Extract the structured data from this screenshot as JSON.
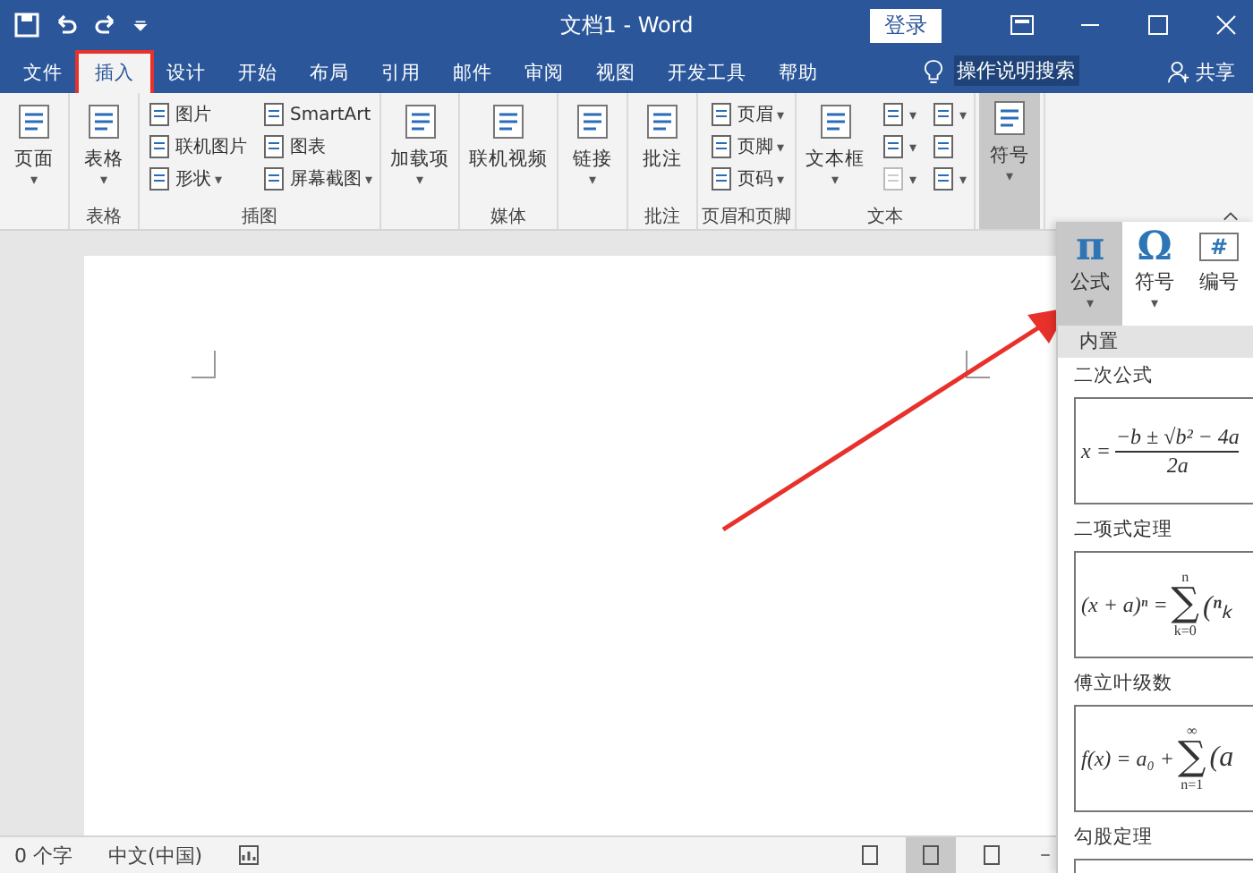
{
  "window": {
    "title": "文档1  -  Word",
    "login": "登录"
  },
  "tabs": [
    {
      "label": "文件",
      "selected": false,
      "highlighted": false
    },
    {
      "label": "插入",
      "selected": true,
      "highlighted": true
    },
    {
      "label": "设计",
      "selected": false,
      "highlighted": false
    },
    {
      "label": "开始",
      "selected": false,
      "highlighted": false
    },
    {
      "label": "布局",
      "selected": false,
      "highlighted": false
    },
    {
      "label": "引用",
      "selected": false,
      "highlighted": false
    },
    {
      "label": "邮件",
      "selected": false,
      "highlighted": false
    },
    {
      "label": "审阅",
      "selected": false,
      "highlighted": false
    },
    {
      "label": "视图",
      "selected": false,
      "highlighted": false
    },
    {
      "label": "开发工具",
      "selected": false,
      "highlighted": false
    },
    {
      "label": "帮助",
      "selected": false,
      "highlighted": false
    }
  ],
  "tell_me": "操作说明搜索",
  "share": "共享",
  "ribbon_groups": [
    {
      "items": [
        {
          "kind": "large",
          "label": "页面",
          "caret": "▾",
          "selected": false
        }
      ]
    },
    {
      "label": "表格",
      "items": [
        {
          "kind": "large",
          "label": "表格",
          "caret": "▾",
          "selected": false
        }
      ]
    },
    {
      "label": "插图",
      "items": [
        {
          "kind": "stack",
          "entries": [
            {
              "label": "图片",
              "disabled": false
            },
            {
              "label": "联机图片",
              "disabled": false
            },
            {
              "label": "形状",
              "caret": "▾",
              "disabled": false
            }
          ]
        },
        {
          "kind": "stack",
          "entries": [
            {
              "label": "SmartArt",
              "disabled": false
            },
            {
              "label": "图表",
              "disabled": false
            },
            {
              "label": "屏幕截图",
              "caret": "▾",
              "disabled": false
            }
          ]
        }
      ]
    },
    {
      "items": [
        {
          "kind": "large",
          "label": "加载项",
          "caret": "▾",
          "selected": false
        }
      ]
    },
    {
      "label": "媒体",
      "items": [
        {
          "kind": "large",
          "label": "联机视频",
          "selected": false
        }
      ]
    },
    {
      "items": [
        {
          "kind": "large",
          "label": "链接",
          "caret": "▾",
          "selected": false
        }
      ]
    },
    {
      "label": "批注",
      "items": [
        {
          "kind": "large",
          "label": "批注",
          "selected": false
        }
      ]
    },
    {
      "label": "页眉和页脚",
      "items": [
        {
          "kind": "stack",
          "entries": [
            {
              "label": "页眉",
              "caret": "▾",
              "disabled": false
            },
            {
              "label": "页脚",
              "caret": "▾",
              "disabled": false
            },
            {
              "label": "页码",
              "caret": "▾",
              "disabled": false
            }
          ]
        }
      ]
    },
    {
      "label": "文本",
      "items": [
        {
          "kind": "large",
          "label": "文本框",
          "caret": "▾",
          "selected": false
        },
        {
          "kind": "stack",
          "entries": [
            {
              "caret": "▾",
              "disabled": false
            },
            {
              "caret": "▾",
              "disabled": false
            },
            {
              "caret": "▾",
              "disabled": true
            }
          ]
        },
        {
          "kind": "stack",
          "entries": [
            {
              "caret": "▾",
              "disabled": false
            },
            {
              "disabled": false
            },
            {
              "caret": "▾",
              "disabled": false
            }
          ]
        }
      ]
    },
    {
      "items": [
        {
          "kind": "large",
          "label": "符号",
          "caret": "▾",
          "selected": true
        }
      ]
    }
  ],
  "symbol_menu": {
    "buttons": [
      {
        "glyph": "π",
        "label": "公式",
        "caret": "▾",
        "selected": true
      },
      {
        "glyph": "Ω",
        "label": "符号",
        "caret": "▾",
        "selected": false
      },
      {
        "glyph": "#",
        "label": "编号",
        "selected": false
      }
    ],
    "section": "内置",
    "equations": [
      {
        "title": "二次公式",
        "kind": "fraction",
        "lhs": "x =",
        "numerator": "−b ± √b² − 4a",
        "denominator": "2a"
      },
      {
        "title": "二项式定理",
        "kind": "sum",
        "lhs": "(x + a)ⁿ =",
        "operator": "∑",
        "upper": "n",
        "lower": "k=0",
        "rest": "(ⁿₖ"
      },
      {
        "title": "傅立叶级数",
        "kind": "sum",
        "lhs": "f(x) = a₀ +",
        "operator": "∑",
        "upper": "∞",
        "lower": "n=1",
        "rest": "(a"
      },
      {
        "title": "勾股定理",
        "kind": "cut"
      }
    ]
  },
  "status_bar": {
    "words": "0 个字",
    "language": "中文(中国)",
    "views": [
      {
        "selected": false
      },
      {
        "selected": true
      },
      {
        "selected": false
      }
    ]
  }
}
